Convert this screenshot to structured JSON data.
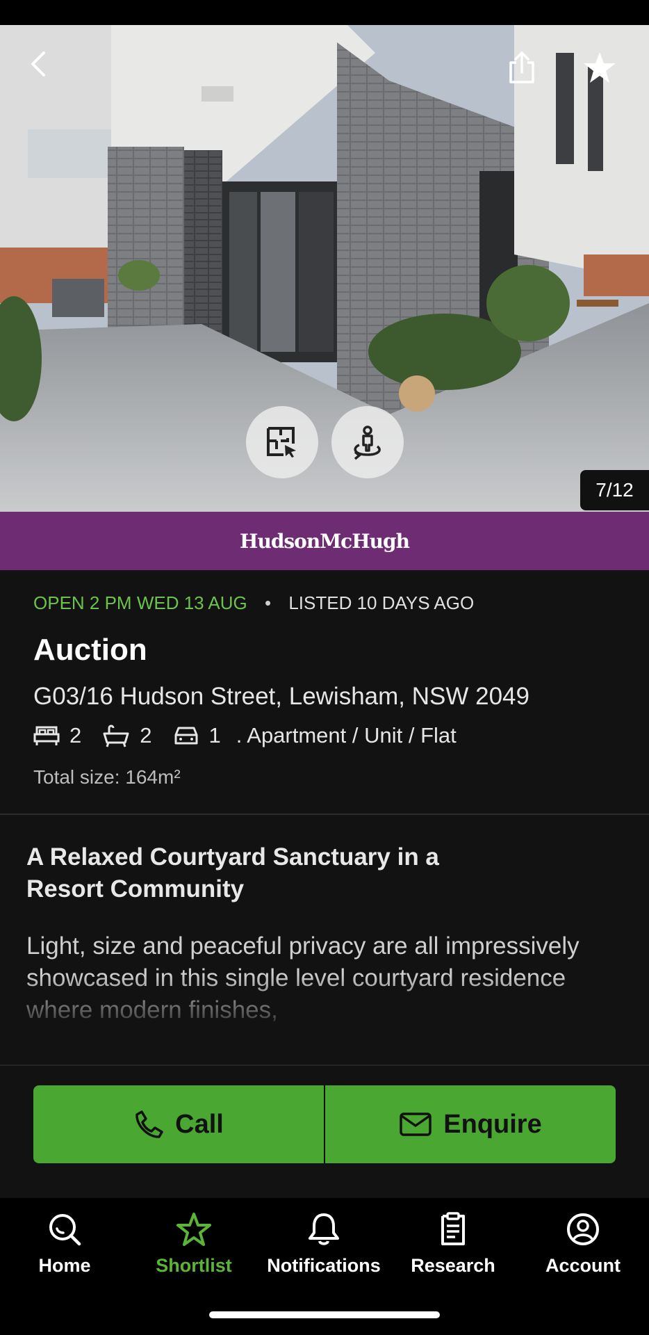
{
  "gallery": {
    "counter": "7/12",
    "icons": {
      "back": "chevron-left-icon",
      "share": "share-icon",
      "shortlist": "star-icon",
      "floorplan": "floorplan-icon",
      "tour": "360-tour-icon"
    }
  },
  "agency": {
    "name": "HudsonMcHugh",
    "brand_color": "#6e2c73"
  },
  "listing": {
    "open_time": "OPEN 2 PM WED 13 AUG",
    "separator": "•",
    "listed": "LISTED 10 DAYS AGO",
    "sale_type": "Auction",
    "address": "G03/16 Hudson Street, Lewisham, NSW 2049",
    "bedrooms": "2",
    "bathrooms": "2",
    "parking": "1",
    "property_type": ". Apartment / Unit / Flat",
    "total_size": "Total size: 164m²",
    "accent_color": "#6cc24a"
  },
  "description": {
    "title": "A Relaxed Courtyard Sanctuary in a Resort Community",
    "body": "Light, size and peaceful privacy are all impressively showcased in this single level courtyard residence where modern finishes,"
  },
  "actions": {
    "call_label": "Call",
    "enquire_label": "Enquire",
    "button_color": "#4aa832"
  },
  "nav": {
    "items": [
      {
        "label": "Home",
        "icon": "search-icon",
        "active": false
      },
      {
        "label": "Shortlist",
        "icon": "star-outline-icon",
        "active": true
      },
      {
        "label": "Notifications",
        "icon": "bell-icon",
        "active": false
      },
      {
        "label": "Research",
        "icon": "clipboard-icon",
        "active": false
      },
      {
        "label": "Account",
        "icon": "user-circle-icon",
        "active": false
      }
    ],
    "active_color": "#5bb537"
  }
}
